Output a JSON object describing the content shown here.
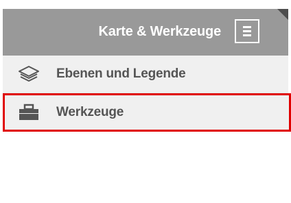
{
  "header": {
    "title": "Karte & Werkzeuge",
    "menu_icon": "hamburger-icon",
    "background": "#999999"
  },
  "menu": {
    "items": [
      {
        "label": "Ebenen und Legende",
        "icon": "layers-icon"
      },
      {
        "label": "Werkzeuge",
        "icon": "toolbox-icon",
        "highlighted": true
      }
    ]
  },
  "colors": {
    "highlight_border": "#e00000",
    "item_background": "#f0f0f0",
    "label_text": "#555555"
  }
}
